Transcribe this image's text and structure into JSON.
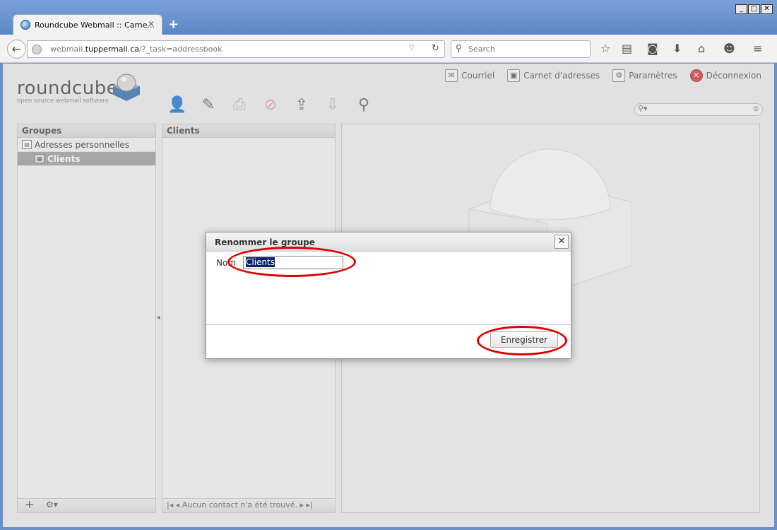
{
  "browser": {
    "tab_title": "Roundcube Webmail :: Carne...",
    "tab_close": "✕",
    "new_tab": "+",
    "url_host": "webmail.",
    "url_domain": "tuppermail.ca",
    "url_path": "/?_task=addressbook",
    "search_placeholder": "Search",
    "window_controls": [
      "_",
      "□",
      "✕"
    ]
  },
  "app": {
    "logo_word": "roundcube",
    "logo_sub": "open source webmail software",
    "topnav": [
      {
        "label": "Courriel",
        "icon": "mail-icon"
      },
      {
        "label": "Carnet d'adresses",
        "icon": "addressbook-icon"
      },
      {
        "label": "Paramètres",
        "icon": "settings-icon"
      },
      {
        "label": "Déconnexion",
        "icon": "logout-icon"
      }
    ]
  },
  "groups_panel": {
    "title": "Groupes",
    "items": [
      {
        "label": "Adresses personnelles",
        "selected": false
      },
      {
        "label": "Clients",
        "selected": true
      }
    ],
    "footer_add": "+",
    "footer_options": "⚙▾"
  },
  "contacts_panel": {
    "title": "Clients",
    "footer_message": "Aucun contact n'a été trouvé."
  },
  "dialog": {
    "title": "Renommer le groupe",
    "close": "✕",
    "field_label": "Nom",
    "field_value": "Clients",
    "save_label": "Enregistrer"
  },
  "colors": {
    "annotation_red": "#e00000",
    "selected_group_bg": "#9d9d9d",
    "selection_highlight": "#0a246a"
  }
}
